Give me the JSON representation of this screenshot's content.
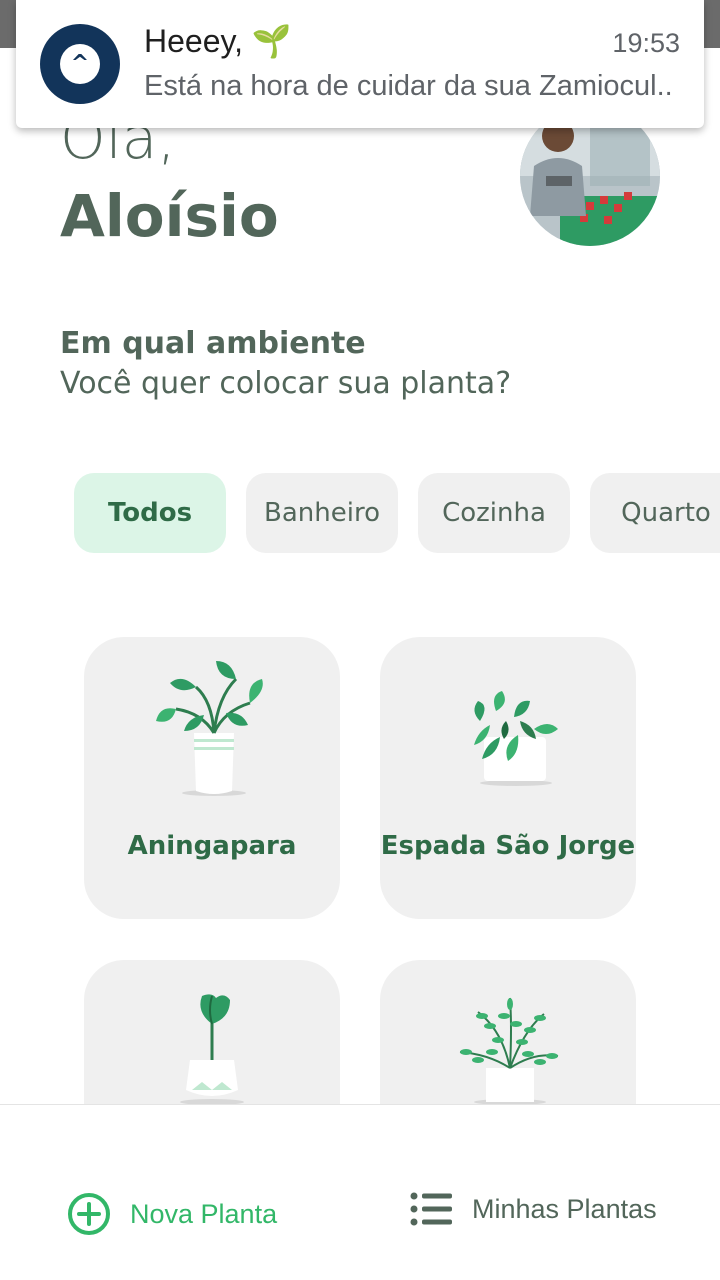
{
  "notification": {
    "app_icon": "expo-caret-icon",
    "title": "Heeey, 🌱",
    "time": "19:53",
    "body": "Está na hora de cuidar da sua Zamiocul.."
  },
  "header": {
    "greeting": "Olá,",
    "user_name": "Aloísio"
  },
  "prompt": {
    "title": "Em qual ambiente",
    "subtitle": "Você quer colocar sua planta?"
  },
  "environments": {
    "selected": "Todos",
    "items": [
      {
        "label": "Todos"
      },
      {
        "label": "Banheiro"
      },
      {
        "label": "Cozinha"
      },
      {
        "label": "Quarto"
      }
    ]
  },
  "plants": [
    {
      "name": "Aningapara"
    },
    {
      "name": "Espada São Jorge"
    },
    {
      "name": ""
    },
    {
      "name": ""
    }
  ],
  "bottom_nav": {
    "new_plant": "Nova Planta",
    "new_plant_icon": "plus-circle-icon",
    "my_plants": "Minhas Plantas",
    "my_plants_icon": "list-icon"
  },
  "colors": {
    "green": "#32b768",
    "dark_green": "#2f6b47",
    "heading": "#52665a",
    "chip_active": "#dcf5e7",
    "card_bg": "#f0f0f0",
    "notif_icon": "#12345a"
  }
}
